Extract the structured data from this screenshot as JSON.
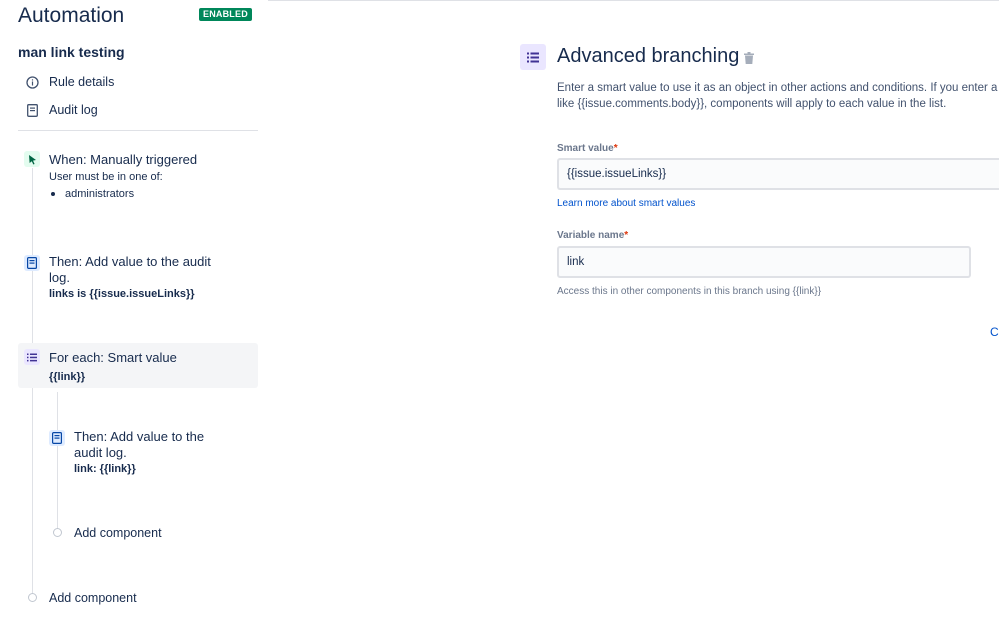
{
  "header": {
    "app_title": "Automation",
    "status_badge": "ENABLED",
    "rule_name": "man link testing"
  },
  "nav": [
    {
      "label": "Rule details",
      "icon": "info-icon"
    },
    {
      "label": "Audit log",
      "icon": "document-icon"
    }
  ],
  "timeline": {
    "trigger": {
      "title": "When: Manually triggered",
      "subtitle": "User must be in one of:",
      "groups": [
        "administrators"
      ],
      "icon": "cursor-click-icon"
    },
    "action1": {
      "title_line1": "Then: Add value to the audit",
      "title_line2": "log.",
      "detail": "links is {{issue.issueLinks}}",
      "icon": "audit-log-icon"
    },
    "branch": {
      "title": "For each: Smart value",
      "detail": "{{link}}",
      "icon": "branch-list-icon"
    },
    "nested_action": {
      "title_line1": "Then: Add value to the",
      "title_line2": "audit log.",
      "detail": "link: {{link}}",
      "icon": "audit-log-icon"
    },
    "nested_add": "Add component",
    "root_add": "Add component"
  },
  "panel": {
    "title": "Advanced branching",
    "description_line1": "Enter a smart value to use it as an object in other actions and conditions. If you enter a",
    "description_line2": "like {{issue.comments.body}}, components will apply to each value in the list.",
    "smart_value": {
      "label": "Smart value",
      "required_mark": "*",
      "value": "{{issue.issueLinks}}",
      "help_link": "Learn more about smart values"
    },
    "variable_name": {
      "label": "Variable name",
      "required_mark": "*",
      "value": "link",
      "hint": "Access this in other components in this branch using {{link}}"
    },
    "cancel_link": "Ca"
  },
  "colors": {
    "badge_green": "#00875a",
    "link_blue": "#0052cc",
    "branch_purple_bg": "#eae6ff",
    "trigger_green_bg": "#e3fcef",
    "action_blue_bg": "#deebff",
    "required_red": "#de350b"
  }
}
